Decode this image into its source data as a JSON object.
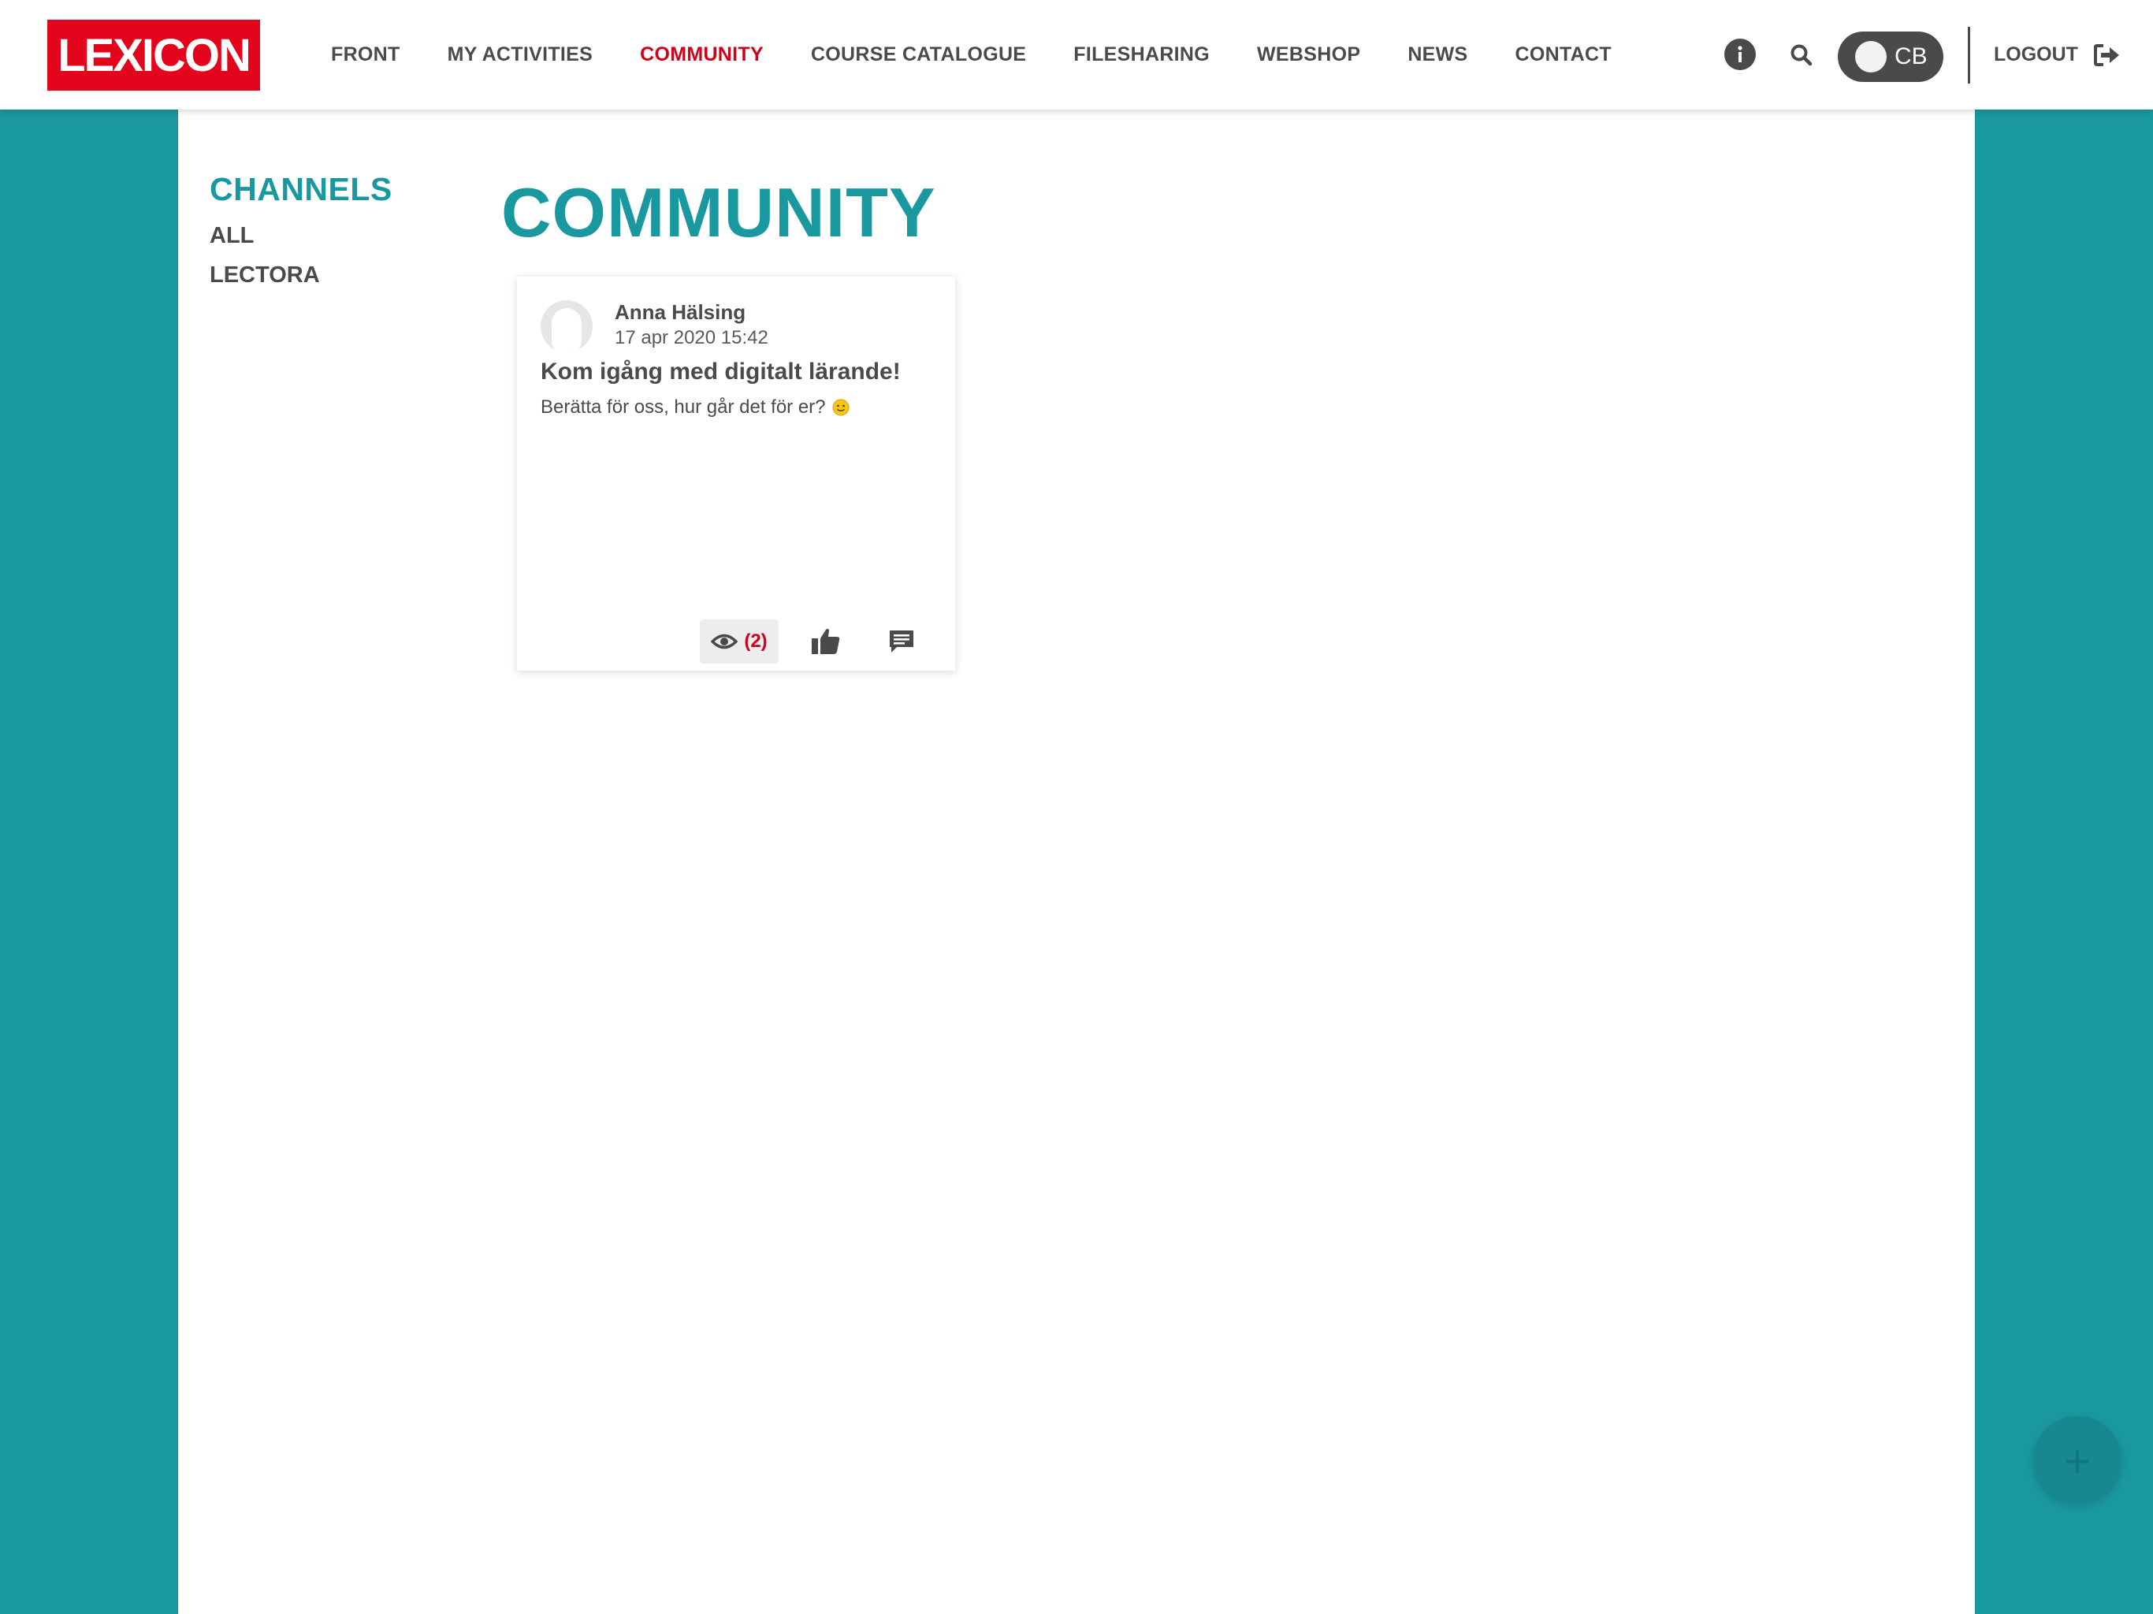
{
  "header": {
    "logo_text": "LEXICON",
    "nav": [
      {
        "label": "FRONT",
        "active": false
      },
      {
        "label": "MY ACTIVITIES",
        "active": false
      },
      {
        "label": "COMMUNITY",
        "active": true
      },
      {
        "label": "COURSE CATALOGUE",
        "active": false
      },
      {
        "label": "FILESHARING",
        "active": false
      },
      {
        "label": "WEBSHOP",
        "active": false
      },
      {
        "label": "NEWS",
        "active": false
      },
      {
        "label": "CONTACT",
        "active": false
      }
    ],
    "user_initials": "CB",
    "logout_label": "LOGOUT",
    "icons": [
      "info-icon",
      "search-icon",
      "logout-icon"
    ]
  },
  "sidebar": {
    "title": "CHANNELS",
    "items": [
      {
        "label": "ALL"
      },
      {
        "label": "LECTORA"
      }
    ]
  },
  "main": {
    "title": "COMMUNITY",
    "posts": [
      {
        "author": "Anna Hälsing",
        "date": "17 apr 2020 15:42",
        "title": "Kom igång med digitalt lärande!",
        "text": "Berätta för oss, hur går det för er?",
        "views": "(2)",
        "icons": [
          "eye-icon",
          "thumbs-up-icon",
          "comment-icon"
        ]
      }
    ]
  },
  "fab": {
    "label": "+"
  },
  "colors": {
    "accent": "#1a98a0",
    "brand_red": "#e3051b",
    "active_nav": "#d0021b",
    "text": "#4a4a4a"
  }
}
